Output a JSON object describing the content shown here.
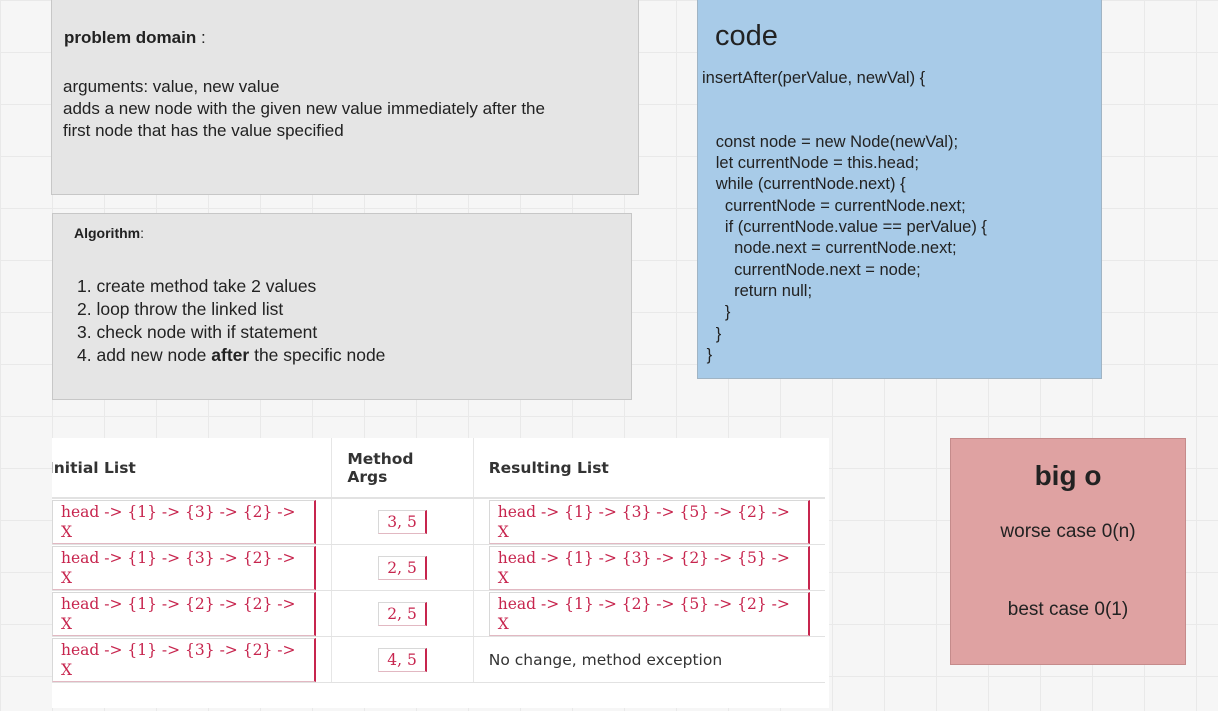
{
  "problem": {
    "heading": "problem domain",
    "heading_suffix": " :",
    "line1": "arguments: value, new value",
    "line2": "adds a new node with the given new value immediately after the",
    "line3": "first node  that has the value specified"
  },
  "algorithm": {
    "heading": "Algorithm",
    "heading_suffix": ":",
    "steps": [
      "1. create method take 2 values",
      "2. loop throw the linked list",
      "3. check node with if statement"
    ],
    "step4_prefix": "4. add new node ",
    "step4_bold": "after",
    "step4_suffix": " the specific node"
  },
  "code": {
    "heading": "code",
    "body": "insertAfter(perValue, newVal) {\n\n\n   const node = new Node(newVal);\n   let currentNode = this.head;\n   while (currentNode.next) {\n     currentNode = currentNode.next;\n     if (currentNode.value == perValue) {\n       node.next = currentNode.next;\n       currentNode.next = node;\n       return null;\n     }\n   }\n }"
  },
  "bigo": {
    "heading": "big o",
    "worst": "worse case 0(n)",
    "best": "best case 0(1)"
  },
  "table": {
    "headers": [
      "Initial List",
      "Method Args",
      "Resulting List"
    ],
    "rows": [
      {
        "initial": "head -> {1} -> {3} -> {2} -> X",
        "args": "3, 5",
        "result": "head -> {1} -> {3} -> {5} -> {2} -> X"
      },
      {
        "initial": "head -> {1} -> {3} -> {2} -> X",
        "args": "2, 5",
        "result": "head -> {1} -> {3} -> {2} -> {5} -> X"
      },
      {
        "initial": "head -> {1} -> {2} -> {2} -> X",
        "args": "2, 5",
        "result": "head -> {1} -> {2} -> {5} -> {2} -> X"
      },
      {
        "initial": "head -> {1} -> {3} -> {2} -> X",
        "args": "4, 5",
        "result": "No change, method exception"
      }
    ]
  }
}
